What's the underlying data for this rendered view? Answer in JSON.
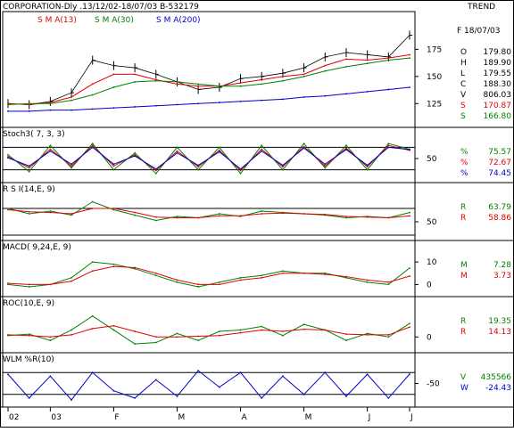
{
  "header": {
    "title": "CORPORATION-Dly .13/12/02-18/07/03  B-532179",
    "trend_label": "TREND"
  },
  "colors": {
    "price": "#000000",
    "red": "#e00000",
    "green": "#008000",
    "blue": "#0000cc",
    "frame": "#000000"
  },
  "chart_data": [
    {
      "type": "line",
      "panel": "price",
      "legend": [
        {
          "name": "S M A(13)",
          "color": "#e00000"
        },
        {
          "name": "S M A(30)",
          "color": "#008000"
        },
        {
          "name": "S M A(200)",
          "color": "#0000cc"
        }
      ],
      "yticks": [
        "175",
        "150",
        "125"
      ],
      "ylim": [
        108,
        195
      ],
      "series": [
        {
          "name": "S M A(13)",
          "values": [
            125,
            124,
            126,
            131,
            143,
            152,
            152,
            147,
            143,
            141,
            141,
            144,
            147,
            150,
            152,
            160,
            166,
            165,
            167,
            170
          ]
        },
        {
          "name": "S M A(30)",
          "values": [
            124,
            125,
            125,
            128,
            133,
            140,
            145,
            146,
            145,
            143,
            141,
            141,
            143,
            146,
            150,
            155,
            159,
            162,
            165,
            167
          ]
        },
        {
          "name": "S M A(200)",
          "values": [
            118,
            118,
            119,
            119,
            120,
            121,
            122,
            123,
            124,
            125,
            126,
            127,
            128,
            129,
            131,
            132,
            134,
            136,
            138,
            140
          ]
        }
      ],
      "price_close": [
        125,
        124,
        127,
        135,
        165,
        160,
        158,
        152,
        145,
        138,
        140,
        148,
        150,
        153,
        158,
        168,
        172,
        170,
        168,
        188
      ],
      "info": {
        "date": "F 18/07/03",
        "rows": [
          {
            "label": "O",
            "value": "179.80",
            "color": "#000000"
          },
          {
            "label": "H",
            "value": "189.90",
            "color": "#000000"
          },
          {
            "label": "L",
            "value": "179.55",
            "color": "#000000"
          },
          {
            "label": "C",
            "value": "188.30",
            "color": "#000000"
          },
          {
            "label": "V",
            "value": "806.03",
            "color": "#000000"
          },
          {
            "label": "S",
            "value": "170.87",
            "color": "#e00000"
          },
          {
            "label": "S",
            "value": "166.80",
            "color": "#008000"
          }
        ]
      }
    },
    {
      "type": "line",
      "panel": "stochastic",
      "title": "Stoch3( 7, 3, 3)",
      "yticks": [
        "50"
      ],
      "ylim": [
        0,
        100
      ],
      "levels": [
        80,
        20
      ],
      "series": [
        {
          "name": "%K",
          "values": [
            60,
            15,
            85,
            25,
            90,
            20,
            65,
            10,
            80,
            20,
            80,
            10,
            85,
            20,
            90,
            25,
            85,
            20,
            90,
            75
          ]
        },
        {
          "name": "%D",
          "values": [
            55,
            25,
            75,
            30,
            85,
            30,
            60,
            18,
            70,
            28,
            72,
            18,
            75,
            28,
            82,
            30,
            78,
            28,
            85,
            72
          ]
        },
        {
          "name": "%D slow",
          "values": [
            52,
            30,
            70,
            35,
            80,
            35,
            57,
            22,
            65,
            32,
            68,
            22,
            70,
            32,
            78,
            35,
            74,
            32,
            80,
            74
          ]
        }
      ],
      "values": [
        {
          "label": "%",
          "value": "75.57",
          "color": "#008000"
        },
        {
          "label": "%",
          "value": "72.67",
          "color": "#e00000"
        },
        {
          "label": "%",
          "value": "74.45",
          "color": "#0000cc"
        }
      ]
    },
    {
      "type": "line",
      "panel": "rsi",
      "title": "R S I(14,E, 9)",
      "yticks": [
        "50"
      ],
      "ylim": [
        30,
        90
      ],
      "levels": [
        70,
        30
      ],
      "series": [
        {
          "name": "RSI",
          "values": [
            70,
            62,
            66,
            60,
            80,
            68,
            60,
            52,
            58,
            56,
            62,
            58,
            66,
            64,
            62,
            60,
            56,
            58,
            56,
            63.79
          ]
        },
        {
          "name": "Signal",
          "values": [
            68,
            65,
            64,
            62,
            70,
            70,
            64,
            57,
            56,
            56,
            59,
            59,
            62,
            63,
            62,
            61,
            58,
            57,
            56,
            58.86
          ]
        }
      ],
      "values": [
        {
          "label": "R",
          "value": "63.79",
          "color": "#008000"
        },
        {
          "label": "R",
          "value": "58.86",
          "color": "#e00000"
        }
      ]
    },
    {
      "type": "line",
      "panel": "macd",
      "title": "MACD( 9,24,E, 9)",
      "yticks": [
        "10",
        "0"
      ],
      "ylim": [
        -3,
        14
      ],
      "series": [
        {
          "name": "MACD",
          "values": [
            0,
            -1,
            0,
            3,
            10,
            9,
            7,
            4,
            1,
            -1,
            1,
            3,
            4,
            6,
            5,
            5,
            3,
            1,
            0,
            7.28
          ]
        },
        {
          "name": "Signal",
          "values": [
            0.5,
            0,
            0,
            1.5,
            6,
            8,
            7.5,
            5,
            2,
            0,
            0,
            2,
            3,
            5,
            5,
            4.5,
            3.5,
            2,
            1,
            3.73
          ]
        }
      ],
      "values": [
        {
          "label": "M",
          "value": "7.28",
          "color": "#008000"
        },
        {
          "label": "M",
          "value": "3.73",
          "color": "#e00000"
        }
      ]
    },
    {
      "type": "line",
      "panel": "roc",
      "title": "ROC(10,E, 9)",
      "yticks": [
        "0"
      ],
      "ylim": [
        -15,
        40
      ],
      "series": [
        {
          "name": "ROC",
          "values": [
            2,
            4,
            -5,
            10,
            30,
            10,
            -10,
            -8,
            5,
            -5,
            8,
            10,
            15,
            2,
            18,
            10,
            -5,
            5,
            0,
            19.35
          ]
        },
        {
          "name": "Signal",
          "values": [
            3,
            2,
            0,
            3,
            12,
            16,
            8,
            0,
            0,
            1,
            2,
            6,
            10,
            8,
            11,
            10,
            4,
            3,
            3,
            14.13
          ]
        }
      ],
      "values": [
        {
          "label": "R",
          "value": "19.35",
          "color": "#008000"
        },
        {
          "label": "R",
          "value": "14.13",
          "color": "#e00000"
        }
      ]
    },
    {
      "type": "line",
      "panel": "williams",
      "title": "WLM %R(10)",
      "yticks": [
        "-50"
      ],
      "ylim": [
        -100,
        0
      ],
      "levels": [
        -20,
        -80
      ],
      "series": [
        {
          "name": "%R",
          "values": [
            -25,
            -90,
            -30,
            -95,
            -20,
            -70,
            -90,
            -40,
            -85,
            -15,
            -60,
            -20,
            -90,
            -30,
            -80,
            -20,
            -85,
            -25,
            -90,
            -24.43
          ]
        }
      ],
      "values": [
        {
          "label": "V",
          "value": "435566",
          "color": "#008000"
        },
        {
          "label": "W",
          "value": "-24.43",
          "color": "#0000cc"
        }
      ]
    }
  ],
  "xaxis": {
    "ticks": [
      {
        "label": "02",
        "i": 0
      },
      {
        "label": "03",
        "i": 2
      },
      {
        "label": "F",
        "i": 5
      },
      {
        "label": "M",
        "i": 8
      },
      {
        "label": "A",
        "i": 11
      },
      {
        "label": "M",
        "i": 14
      },
      {
        "label": "J",
        "i": 17
      },
      {
        "label": "J",
        "i": 19
      }
    ]
  }
}
